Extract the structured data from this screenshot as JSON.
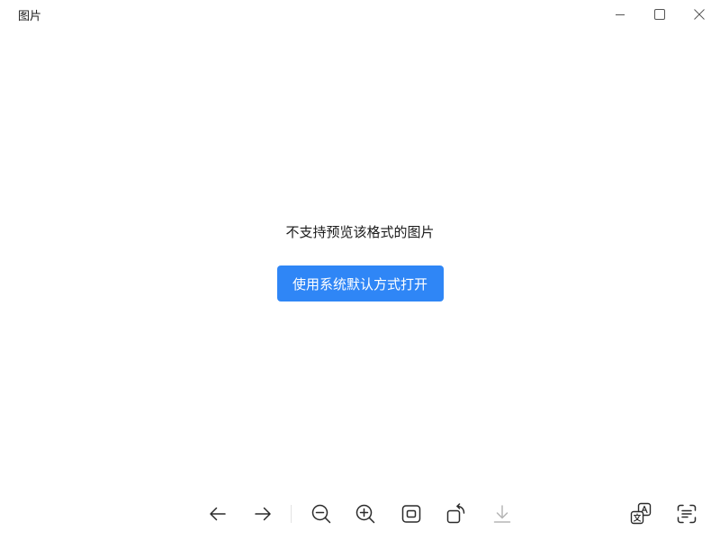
{
  "window": {
    "title": "图片"
  },
  "window_controls": [
    {
      "name": "minimize-icon"
    },
    {
      "name": "maximize-icon"
    },
    {
      "name": "close-icon"
    }
  ],
  "main": {
    "message": "不支持预览该格式的图片",
    "open_button_label": "使用系统默认方式打开"
  },
  "toolbar": {
    "icons": [
      "arrow-left-icon",
      "arrow-right-icon",
      "zoom-out-icon",
      "zoom-in-icon",
      "fit-window-icon",
      "rotate-icon",
      "download-icon",
      "translate-icon",
      "ocr-scan-icon"
    ],
    "download_disabled": true
  },
  "colors": {
    "accent": "#2f86f6",
    "icon": "#2a2a2a",
    "icon_disabled": "#b5b5b5"
  }
}
